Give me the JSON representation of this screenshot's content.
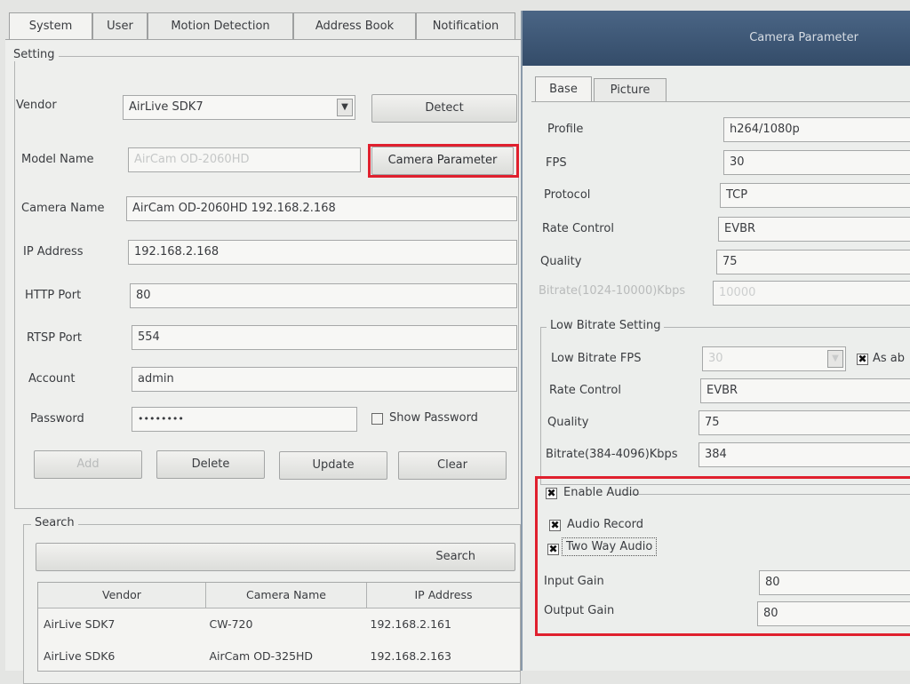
{
  "main_tabs": [
    "System",
    "User",
    "Motion Detection",
    "Address Book",
    "Notification"
  ],
  "setting": {
    "legend": "Setting",
    "vendor_label": "Vendor",
    "vendor_value": "AirLive SDK7",
    "detect_button": "Detect",
    "model_label": "Model Name",
    "model_value": "AirCam OD-2060HD",
    "camera_param_button": "Camera Parameter",
    "camera_name_label": "Camera Name",
    "camera_name_value": "AirCam OD-2060HD 192.168.2.168",
    "ip_label": "IP Address",
    "ip_value": "192.168.2.168",
    "http_label": "HTTP Port",
    "http_value": "80",
    "rtsp_label": "RTSP Port",
    "rtsp_value": "554",
    "account_label": "Account",
    "account_value": "admin",
    "password_label": "Password",
    "password_value": "••••••••",
    "show_password": "Show Password",
    "add_button": "Add",
    "delete_button": "Delete",
    "update_button": "Update",
    "clear_button": "Clear"
  },
  "search": {
    "legend": "Search",
    "button": "Search",
    "columns": [
      "Vendor",
      "Camera Name",
      "IP Address"
    ],
    "rows": [
      [
        "AirLive SDK7",
        "CW-720",
        "192.168.2.161"
      ],
      [
        "AirLive SDK6",
        "AirCam OD-325HD",
        "192.168.2.163"
      ]
    ]
  },
  "dialog": {
    "title": "Camera Parameter",
    "tabs": [
      "Base",
      "Picture"
    ],
    "profile_label": "Profile",
    "profile_value": "h264/1080p",
    "fps_label": "FPS",
    "fps_value": "30",
    "protocol_label": "Protocol",
    "protocol_value": "TCP",
    "rate_label": "Rate Control",
    "rate_value": "EVBR",
    "quality_label": "Quality",
    "quality_value": "75",
    "bitrate_label": "Bitrate(1024-10000)Kbps",
    "bitrate_value": "10000",
    "low": {
      "legend": "Low Bitrate Setting",
      "fps_label": "Low Bitrate FPS",
      "fps_value": "30",
      "as_above": "As ab",
      "rate_label": "Rate Control",
      "rate_value": "EVBR",
      "quality_label": "Quality",
      "quality_value": "75",
      "bitrate_label": "Bitrate(384-4096)Kbps",
      "bitrate_value": "384"
    },
    "audio": {
      "enable_label": "Enable Audio",
      "record_label": "Audio Record",
      "two_way_label": "Two Way Audio",
      "input_gain_label": "Input Gain",
      "input_gain_value": "80",
      "output_gain_label": "Output Gain",
      "output_gain_value": "80"
    },
    "check_mark": "✖"
  },
  "colors": {
    "highlight": "#e0202e",
    "dialog_title_bg": "#3f5a7a"
  }
}
